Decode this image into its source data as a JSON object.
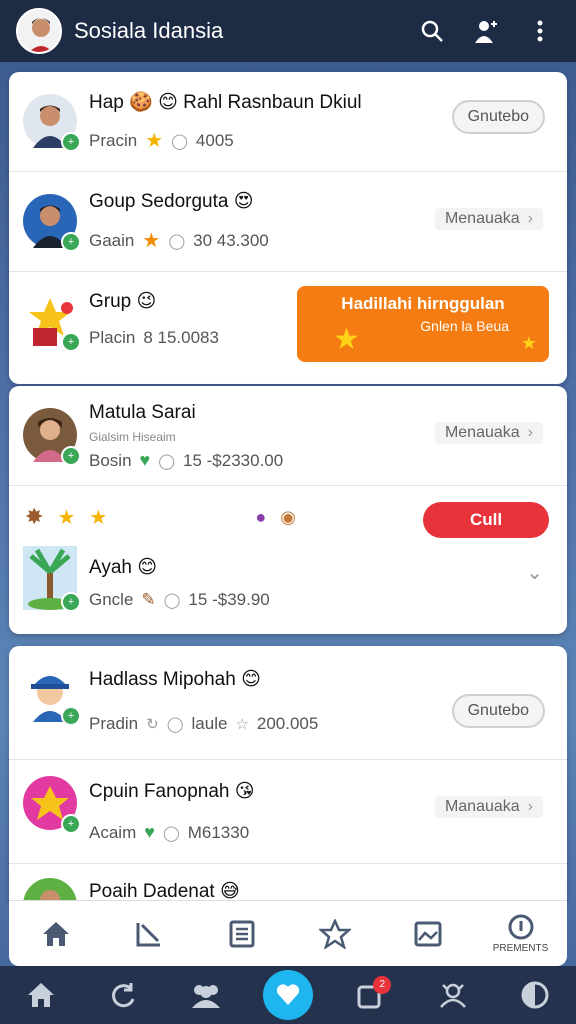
{
  "appbar": {
    "title": "Sosiala Idansia"
  },
  "card1": {
    "rows": [
      {
        "name": "Hap 🍪 😊 Rahl Rasnbaun Dkiul",
        "meta_label": "Pracin",
        "meta_value": "4005",
        "action": "Gnutebo"
      },
      {
        "name": "Goup Sedorguta 😍",
        "meta_label": "Gaain",
        "meta_value": "30 43.300",
        "action": "Menauaka"
      },
      {
        "name": "Grup 😉",
        "meta_label": "Placin",
        "meta_value": "8 15.0083",
        "banner_title": "Hadillahi hirnggulan",
        "banner_sub": "Gnlen la Beua"
      }
    ]
  },
  "card2": {
    "rows": [
      {
        "name": "Matula Sarai",
        "sub": "Gialsim Hiseaim",
        "meta_label": "Bosin",
        "meta_value": "15 -$2330.00",
        "action": "Menauaka"
      },
      {
        "name": "",
        "action": "Cull"
      },
      {
        "name": "Ayah 😊",
        "meta_label": "Gncle",
        "meta_value": "15 -$39.90"
      }
    ]
  },
  "card3": {
    "rows": [
      {
        "name": "Hadlass Mipohah 😊",
        "meta_label": "Pradin",
        "meta_value": "laule",
        "meta_extra": "200.005",
        "action": "Gnutebo"
      },
      {
        "name": "Cpuin Fanopnah 😘",
        "meta_label": "Acaim",
        "meta_value": "M61330",
        "action": "Manauaka"
      },
      {
        "name": "Poaih Dadenat 😅"
      }
    ]
  },
  "tabbar": {
    "last_label": "PREMENTS"
  },
  "sysnav": {
    "notif_count": "2"
  },
  "colors": {
    "accent_orange": "#f47c12",
    "accent_red": "#e8333a",
    "accent_blue": "#1fb6f0",
    "appbar_bg": "#1e2b45"
  }
}
